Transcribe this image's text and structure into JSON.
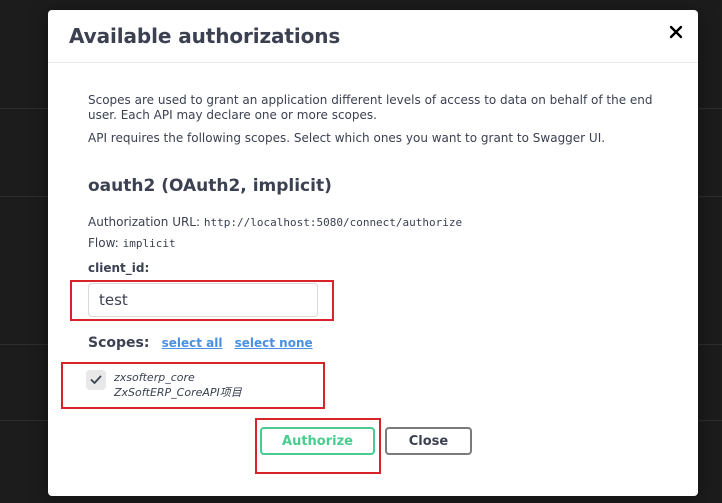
{
  "modal": {
    "title": "Available authorizations",
    "close_icon": "close-icon"
  },
  "description": {
    "line1": "Scopes are used to grant an application different levels of access to data on behalf of the end user. Each API may declare one or more scopes.",
    "line2": "API requires the following scopes. Select which ones you want to grant to Swagger UI."
  },
  "scheme": {
    "title": "oauth2 (OAuth2, implicit)",
    "auth_url_label": "Authorization URL:",
    "auth_url": "http://localhost:5080/connect/authorize",
    "flow_label": "Flow:",
    "flow": "implicit"
  },
  "client_id": {
    "label": "client_id:",
    "value": "test"
  },
  "scopes": {
    "label": "Scopes:",
    "select_all": "select all",
    "select_none": "select none",
    "items": [
      {
        "name": "zxsofterp_core",
        "description": "ZxSoftERP_CoreAPI项目",
        "checked": true
      }
    ]
  },
  "buttons": {
    "authorize": "Authorize",
    "close": "Close"
  },
  "colors": {
    "authorize_green": "#49cc90",
    "link_blue": "#4990e2",
    "highlight_red": "#d9232a",
    "text": "#3b4151"
  }
}
